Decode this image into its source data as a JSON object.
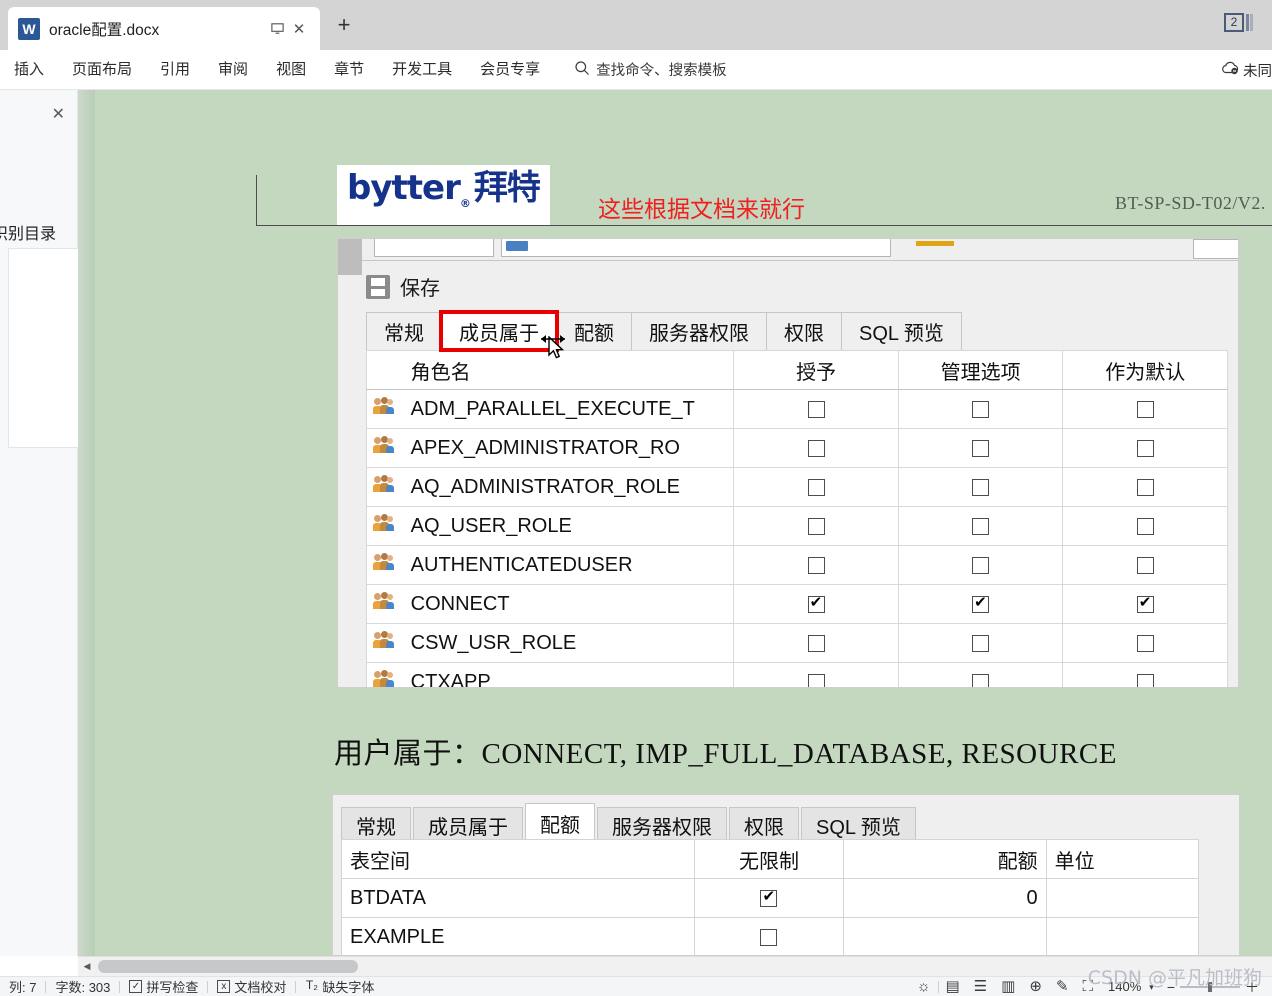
{
  "window": {
    "tab_title": "oracle配置.docx",
    "tab_icon": "wps-writer-icon",
    "restore_label": "⌑",
    "close_label": "✕",
    "new_tab_label": "+",
    "window_badge": "2"
  },
  "ribbon": {
    "menus": [
      "插入",
      "页面布局",
      "引用",
      "审阅",
      "视图",
      "章节",
      "开发工具",
      "会员专享"
    ],
    "search_placeholder": "查找命令、搜索模板",
    "search_icon": "search-icon",
    "sync_label": "未同",
    "sync_icon": "cloud-icon"
  },
  "left_pane": {
    "close_label": "✕",
    "title": "识别目录"
  },
  "document": {
    "logo": {
      "text_main": "bytter",
      "reg": "®",
      "text_cn": "拜特"
    },
    "annotation": "这些根据文档来就行",
    "doc_code": "BT-SP-SD-T02/V2.",
    "paragraph": "用户属于：CONNECT, IMP_FULL_DATABASE,  RESOURCE"
  },
  "screenshot_roles": {
    "save_label": "保存",
    "save_icon": "save-icon",
    "tabs": [
      {
        "label": "常规",
        "selected": false,
        "highlighted": false
      },
      {
        "label": "成员属于",
        "selected": true,
        "highlighted": true
      },
      {
        "label": "配额",
        "selected": false,
        "highlighted": false
      },
      {
        "label": "服务器权限",
        "selected": false,
        "highlighted": false
      },
      {
        "label": "权限",
        "selected": false,
        "highlighted": false
      },
      {
        "label": "SQL 预览",
        "selected": false,
        "highlighted": false
      }
    ],
    "headers": [
      "角色名",
      "授予",
      "管理选项",
      "作为默认"
    ],
    "rows": [
      {
        "name": "ADM_PARALLEL_EXECUTE_T",
        "granted": false,
        "admin": false,
        "default": false
      },
      {
        "name": "APEX_ADMINISTRATOR_RO",
        "granted": false,
        "admin": false,
        "default": false
      },
      {
        "name": "AQ_ADMINISTRATOR_ROLE",
        "granted": false,
        "admin": false,
        "default": false
      },
      {
        "name": "AQ_USER_ROLE",
        "granted": false,
        "admin": false,
        "default": false
      },
      {
        "name": "AUTHENTICATEDUSER",
        "granted": false,
        "admin": false,
        "default": false
      },
      {
        "name": "CONNECT",
        "granted": true,
        "admin": true,
        "default": true
      },
      {
        "name": "CSW_USR_ROLE",
        "granted": false,
        "admin": false,
        "default": false
      },
      {
        "name": "CTXAPP",
        "granted": false,
        "admin": false,
        "default": false
      }
    ]
  },
  "screenshot_quota": {
    "tabs": [
      {
        "label": "常规",
        "selected": false
      },
      {
        "label": "成员属于",
        "selected": false
      },
      {
        "label": "配额",
        "selected": true
      },
      {
        "label": "服务器权限",
        "selected": false
      },
      {
        "label": "权限",
        "selected": false
      },
      {
        "label": "SQL 预览",
        "selected": false
      }
    ],
    "headers": [
      "表空间",
      "无限制",
      "配额",
      "单位"
    ],
    "rows": [
      {
        "tablespace": "BTDATA",
        "unlimited": true,
        "quota": "0",
        "unit": ""
      },
      {
        "tablespace": "EXAMPLE",
        "unlimited": false,
        "quota": "",
        "unit": ""
      }
    ]
  },
  "status_bar": {
    "column": "列: 7",
    "word_count": "字数: 303",
    "spellcheck": "拼写检查",
    "proofread": "文档校对",
    "missing_font": "缺失字体",
    "zoom": "140%",
    "icons": [
      "brightness-icon",
      "page-view-icon",
      "outline-view-icon",
      "read-view-icon",
      "web-view-icon",
      "pen-icon",
      "fullscreen-icon"
    ]
  },
  "watermark": "CSDN @平凡加班狗",
  "colors": {
    "doc_background": "#c3d8bf",
    "annotation_red": "#f02020",
    "highlight_red": "#e80000",
    "logo_blue": "#16338c",
    "logo_orange": "#e8670c"
  }
}
